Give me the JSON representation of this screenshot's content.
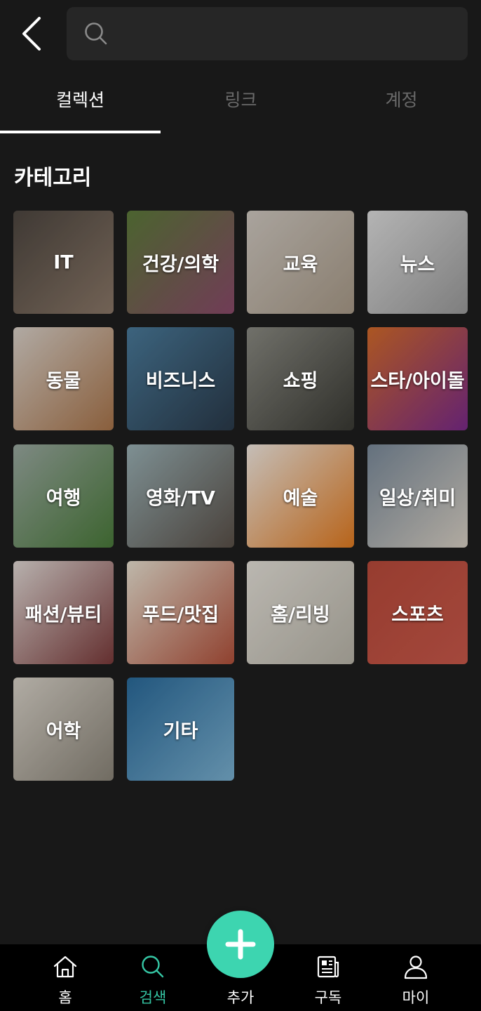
{
  "search": {
    "placeholder": ""
  },
  "tabs": [
    {
      "label": "컬렉션",
      "active": true
    },
    {
      "label": "링크",
      "active": false
    },
    {
      "label": "계정",
      "active": false
    }
  ],
  "category": {
    "title": "카테고리",
    "items": [
      {
        "label": "IT",
        "image": "laptop-coding-photo",
        "colors": [
          "#4d4640",
          "#8b7868"
        ]
      },
      {
        "label": "건강/의학",
        "image": "vegetables-photo",
        "colors": [
          "#5c7a3a",
          "#8a4a6a"
        ]
      },
      {
        "label": "교육",
        "image": "books-blocks-photo",
        "colors": [
          "#cfc8c0",
          "#a89a88"
        ]
      },
      {
        "label": "뉴스",
        "image": "newspaper-photo",
        "colors": [
          "#dcdcdc",
          "#9a9a9a"
        ]
      },
      {
        "label": "동물",
        "image": "cat-photo",
        "colors": [
          "#d8d0c8",
          "#a8744a"
        ]
      },
      {
        "label": "비즈니스",
        "image": "city-skyline-photo",
        "colors": [
          "#4a7a9a",
          "#2a3a4a"
        ]
      },
      {
        "label": "쇼핑",
        "image": "shopping-arcade-photo",
        "colors": [
          "#8a8a82",
          "#3a3a34"
        ]
      },
      {
        "label": "스타/아이돌",
        "image": "microphone-photo",
        "colors": [
          "#d26a2a",
          "#7a2a8a"
        ]
      },
      {
        "label": "여행",
        "image": "forest-field-photo",
        "colors": [
          "#9aa8a0",
          "#4a7a3a"
        ]
      },
      {
        "label": "영화/TV",
        "image": "clapperboard-photo",
        "colors": [
          "#9ab0b4",
          "#5a5048"
        ]
      },
      {
        "label": "예술",
        "image": "paint-photo",
        "colors": [
          "#f0e8e0",
          "#e07a20"
        ]
      },
      {
        "label": "일상/취미",
        "image": "reading-book-photo",
        "colors": [
          "#7a8a9a",
          "#d8d0c4"
        ]
      },
      {
        "label": "패션/뷰티",
        "image": "makeup-palette-photo",
        "colors": [
          "#e0d8d4",
          "#7a3a3a"
        ]
      },
      {
        "label": "푸드/맛집",
        "image": "food-table-photo",
        "colors": [
          "#e8e0d0",
          "#b0503a"
        ]
      },
      {
        "label": "홈/리빙",
        "image": "living-room-photo",
        "colors": [
          "#e4e0d8",
          "#b8b4a8"
        ]
      },
      {
        "label": "스포츠",
        "image": "running-track-photo",
        "colors": [
          "#b84a3a",
          "#c8584a"
        ]
      },
      {
        "label": "어학",
        "image": "dictionary-photo",
        "colors": [
          "#d8d2c8",
          "#8a8478"
        ]
      },
      {
        "label": "기타",
        "image": "flower-vase-photo",
        "colors": [
          "#2a6a9a",
          "#7ab0d0"
        ]
      }
    ]
  },
  "bottom_nav": {
    "items": [
      {
        "label": "홈",
        "icon": "home-icon",
        "active": false
      },
      {
        "label": "검색",
        "icon": "search-icon",
        "active": true
      },
      {
        "label": "추가",
        "icon": "plus-icon",
        "active": false
      },
      {
        "label": "구독",
        "icon": "newspaper-icon",
        "active": false
      },
      {
        "label": "마이",
        "icon": "user-icon",
        "active": false
      }
    ]
  },
  "colors": {
    "background": "#181818",
    "accent": "#35c6a4",
    "fab": "#3dd5b0",
    "search_bg": "#262626",
    "inactive_tab": "#6a6a6a"
  }
}
